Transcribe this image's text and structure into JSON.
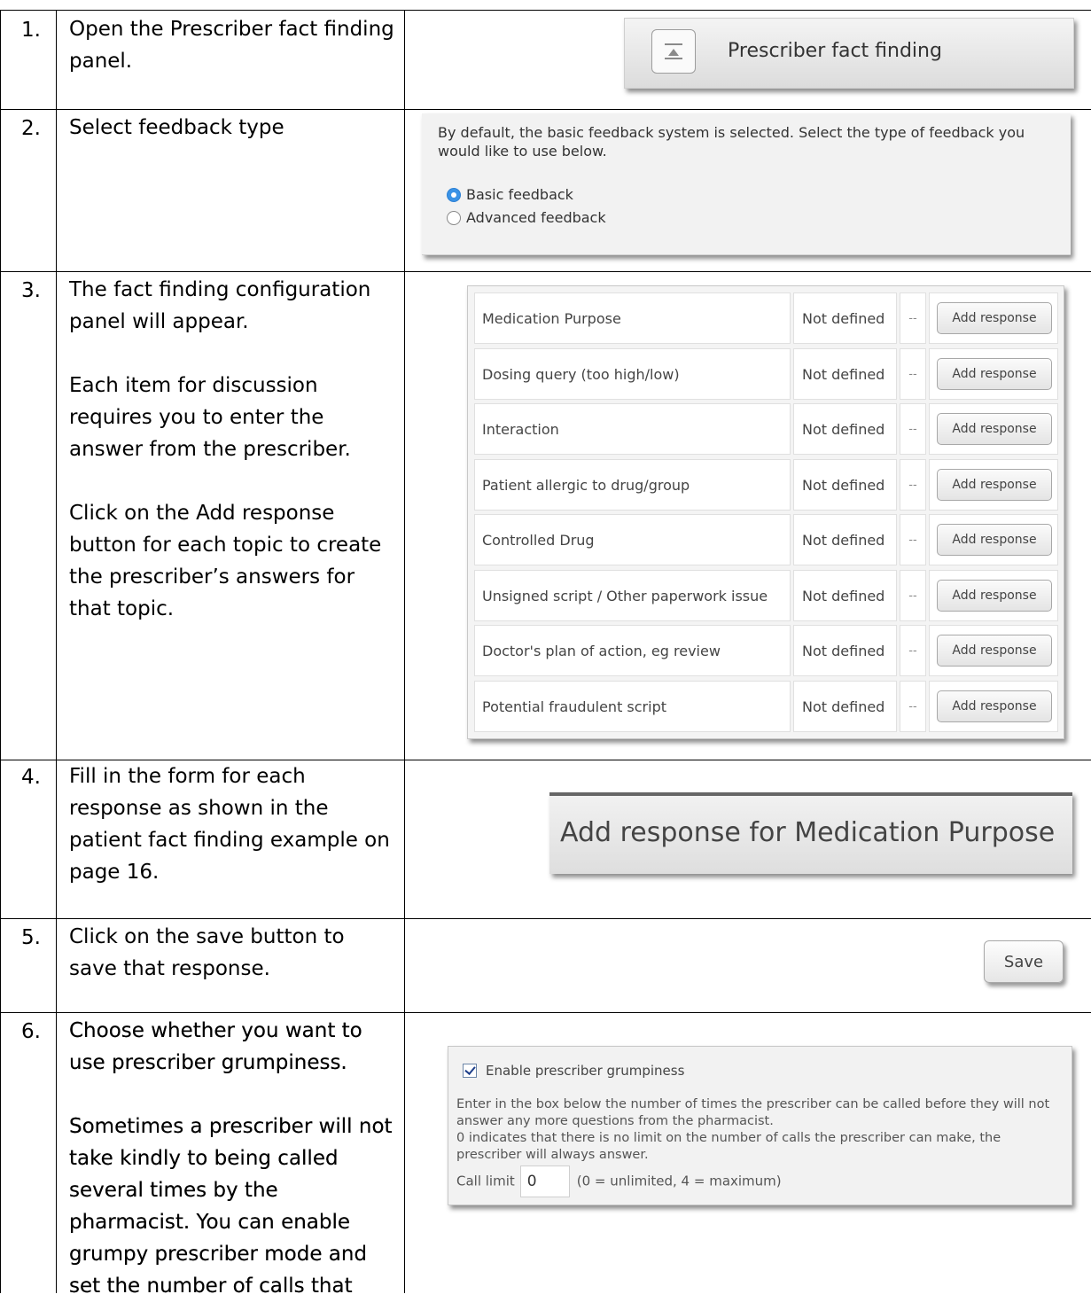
{
  "steps": [
    {
      "num": "1.",
      "text": [
        "Open the Prescriber fact finding panel."
      ]
    },
    {
      "num": "2.",
      "text": [
        "Select feedback type"
      ]
    },
    {
      "num": "3.",
      "text": [
        "The fact finding configuration panel will appear.",
        "Each item for discussion requires you to enter the answer from the prescriber.",
        "Click on the Add response button for each topic to create the prescriber’s answers for that topic."
      ]
    },
    {
      "num": "4.",
      "text": [
        "Fill in the form for each response as shown in the patient fact finding example on page 16."
      ]
    },
    {
      "num": "5.",
      "text": [
        "Click on the save button to save that response."
      ]
    },
    {
      "num": "6.",
      "text": [
        "Choose whether you want to use prescriber grumpiness.",
        "Sometimes a prescriber will not take kindly to being called several times by the pharmacist. You can enable grumpy prescriber mode and set the number of calls that"
      ]
    }
  ],
  "panel_toggle": {
    "label": "Prescriber fact finding",
    "icon": "collapse-up-icon"
  },
  "feedback": {
    "intro": "By default, the basic feedback system is selected. Select the type of feedback you would like to use below.",
    "options": [
      {
        "label": "Basic feedback",
        "selected": true
      },
      {
        "label": "Advanced feedback",
        "selected": false
      }
    ],
    "accent_color": "#3b93e6"
  },
  "fact_finding": {
    "rows": [
      {
        "topic": "Medication Purpose",
        "status": "Not defined",
        "marker": "--",
        "button": "Add response"
      },
      {
        "topic": "Dosing query (too high/low)",
        "status": "Not defined",
        "marker": "--",
        "button": "Add response"
      },
      {
        "topic": "Interaction",
        "status": "Not defined",
        "marker": "--",
        "button": "Add response"
      },
      {
        "topic": "Patient allergic to drug/group",
        "status": "Not defined",
        "marker": "--",
        "button": "Add response"
      },
      {
        "topic": "Controlled Drug",
        "status": "Not defined",
        "marker": "--",
        "button": "Add response"
      },
      {
        "topic": "Unsigned script / Other paperwork issue",
        "status": "Not defined",
        "marker": "--",
        "button": "Add response"
      },
      {
        "topic": "Doctor's plan of action, eg review",
        "status": "Not defined",
        "marker": "--",
        "button": "Add response"
      },
      {
        "topic": "Potential fraudulent script",
        "status": "Not defined",
        "marker": "--",
        "button": "Add response"
      }
    ]
  },
  "add_response": {
    "title": "Add response for Medication Purpose"
  },
  "save": {
    "label": "Save"
  },
  "grumpiness": {
    "checkbox_label": "Enable prescriber grumpiness",
    "checked": true,
    "line1": "Enter in the box below the number of times the prescriber can be called before they will not answer any more questions from the pharmacist.",
    "line2": "0 indicates that there is no limit on the number of calls the prescriber can make, the prescriber will always answer.",
    "call_limit_label": "Call limit",
    "call_limit_value": "0",
    "call_limit_hint": "(0 = unlimited, 4 = maximum)"
  }
}
